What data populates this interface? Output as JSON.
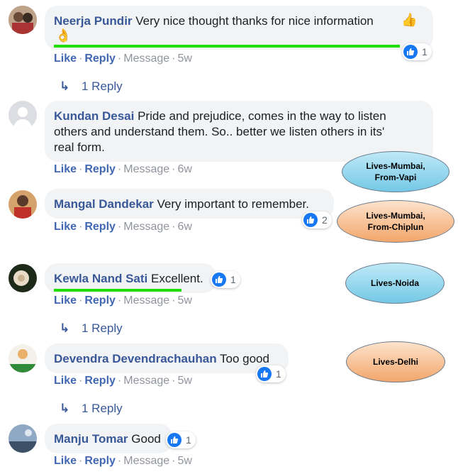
{
  "actions": {
    "like": "Like",
    "reply": "Reply",
    "message": "Message"
  },
  "comments": [
    {
      "author": "Neerja Pundir",
      "text": "Very nice thought thanks for nice information",
      "age": "5w",
      "reactions": "1",
      "replies": "1 Reply"
    },
    {
      "author": "Kundan Desai",
      "text_line1": "Pride and prejudice, comes in the way to listen",
      "text_line2": "others and understand them. So.. better we listen others in its'",
      "text_line3": "real form.",
      "age": "6w"
    },
    {
      "author": "Mangal Dandekar",
      "text": "Very important to remember.",
      "age": "6w",
      "reactions": "2"
    },
    {
      "author": "Kewla Nand Sati",
      "text": "Excellent.",
      "age": "5w",
      "reactions": "1",
      "replies": "1 Reply"
    },
    {
      "author": "Devendra Devendrachauhan",
      "text": "Too good",
      "age": "5w",
      "reactions": "1",
      "replies": "1 Reply"
    },
    {
      "author": "Manju Tomar",
      "text": "Good",
      "age": "5w",
      "reactions": "1"
    }
  ],
  "annotations": {
    "kundan_line1": "Lives-Mumbai,",
    "kundan_line2": "From-Vapi",
    "mangal_line1": "Lives-Mumbai,",
    "mangal_line2": "From-Chiplun",
    "kewla": "Lives-Noida",
    "devendra": "Lives-Delhi"
  },
  "colors": {
    "author": "#385898",
    "like": "#4267b2",
    "meta": "#90949c",
    "bubble": "#f2f3f5",
    "highlight": "#22dd00",
    "reaction": "#1877f2"
  },
  "icons": [
    "thumbs-up-emoji",
    "ok-hand-emoji",
    "like-reaction-icon",
    "reply-arrow-icon",
    "default-avatar-icon"
  ]
}
